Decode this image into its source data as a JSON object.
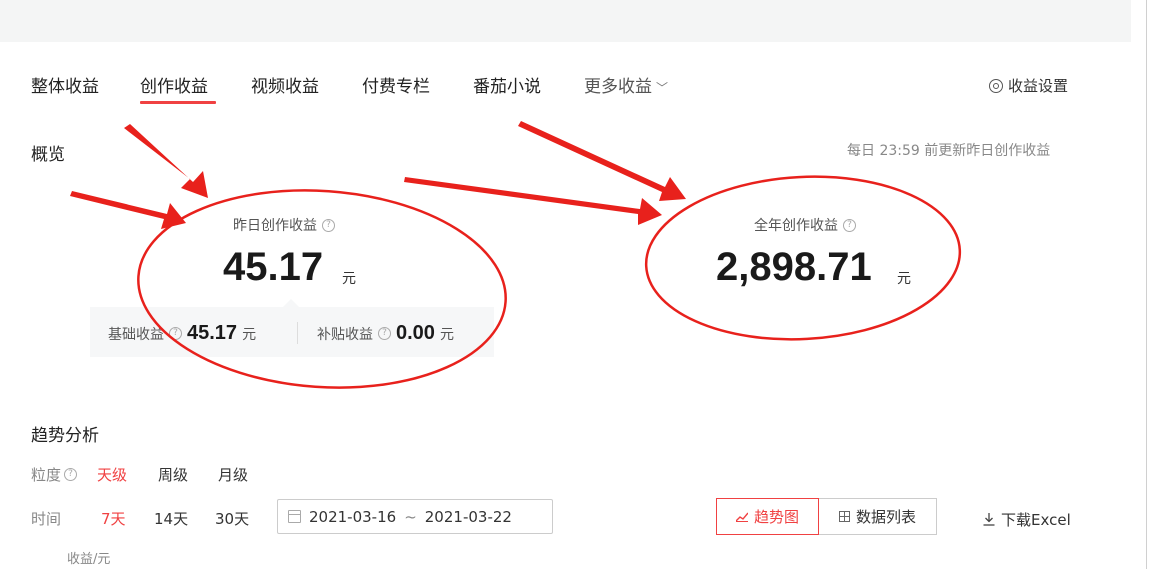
{
  "tabs": [
    {
      "label": "整体收益"
    },
    {
      "label": "创作收益"
    },
    {
      "label": "视频收益"
    },
    {
      "label": "付费专栏"
    },
    {
      "label": "番茄小说"
    },
    {
      "label": "更多收益"
    }
  ],
  "settings_label": "收益设置",
  "overview": {
    "title": "概览",
    "update_note": "每日 23:59 前更新昨日创作收益",
    "yesterday": {
      "label": "昨日创作收益",
      "value": "45.17",
      "unit": "元"
    },
    "year": {
      "label": "全年创作收益",
      "value": "2,898.71",
      "unit": "元"
    },
    "basic": {
      "label": "基础收益",
      "value": "45.17",
      "unit": "元"
    },
    "subsidy": {
      "label": "补贴收益",
      "value": "0.00",
      "unit": "元"
    }
  },
  "trend": {
    "title": "趋势分析",
    "granularity_label": "粒度",
    "granularity_options": [
      "天级",
      "周级",
      "月级"
    ],
    "granularity_selected": "天级",
    "time_label": "时间",
    "time_options": [
      "7天",
      "14天",
      "30天"
    ],
    "time_selected": "7天",
    "date_start": "2021-03-16",
    "date_sep": "~",
    "date_end": "2021-03-22",
    "view_trend_label": "趋势图",
    "view_list_label": "数据列表",
    "download_label": "下载Excel",
    "y_axis_label": "收益/元"
  },
  "colors": {
    "accent": "#f04142",
    "annotation": "#e8211c"
  },
  "help_glyph": "?"
}
